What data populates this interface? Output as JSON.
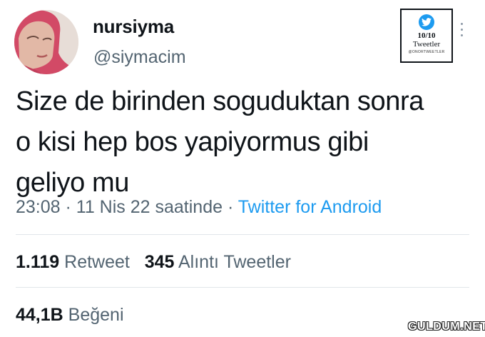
{
  "author": {
    "display_name": "nursiyma",
    "handle": "@siymacim"
  },
  "badge": {
    "score": "10/10",
    "label": "Tweetler",
    "small": "@ONORTWEETLER"
  },
  "tweet": {
    "text_lines": [
      "Size de birinden soguduktan sonra",
      "o kisi hep bos yapiyormus gibi",
      "geliyo mu"
    ],
    "time": "23:08",
    "separator": " · ",
    "date": "11 Nis 22 saatinde",
    "source": "Twitter for Android"
  },
  "stats": {
    "retweets_count": "1.119",
    "retweets_label": "Retweet",
    "quotes_count": "345",
    "quotes_label": "Alıntı Tweetler",
    "likes_count": "44,1B",
    "likes_label": "Beğeni"
  },
  "watermark": "GULDUM.NET",
  "colors": {
    "text": "#0f1419",
    "secondary": "#536471",
    "link": "#1d9bf0",
    "hijab": "#d24a66"
  },
  "icons": [
    "twitter-bird-icon",
    "more-options-icon"
  ]
}
